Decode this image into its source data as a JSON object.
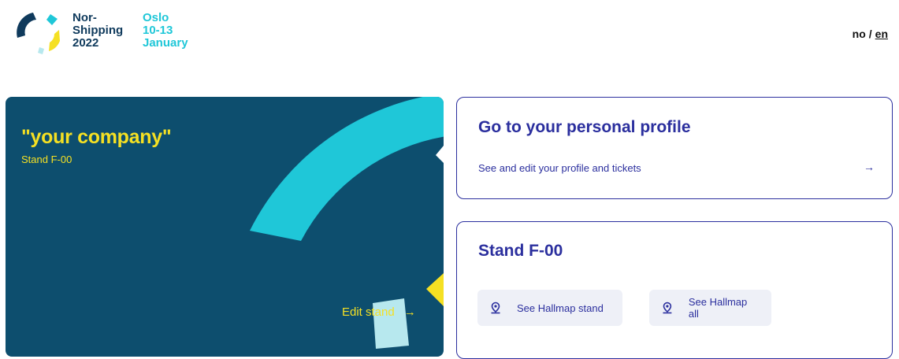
{
  "header": {
    "logo": {
      "name_lines": [
        "Nor-",
        "Shipping",
        "2022"
      ],
      "city_lines": [
        "Oslo",
        "10-13",
        "January"
      ]
    },
    "language": {
      "no": "no",
      "separator": "/",
      "en": "en",
      "active": "en"
    }
  },
  "company_card": {
    "company_name": "\"your company\"",
    "stand_label": "Stand F-00",
    "edit_label": "Edit stand",
    "edit_arrow": "→",
    "colors": {
      "background": "#0d4e6e",
      "accent": "#f5e023",
      "cyan": "#1fc7d8"
    }
  },
  "profile_card": {
    "title": "Go to your personal profile",
    "subtitle": "See and edit your profile and tickets",
    "arrow": "→"
  },
  "stand_card": {
    "title": "Stand F-00",
    "buttons": [
      {
        "label": "See Hallmap stand",
        "icon": "location-pin-icon"
      },
      {
        "label": "See Hallmap all",
        "icon": "location-pin-icon"
      }
    ]
  }
}
